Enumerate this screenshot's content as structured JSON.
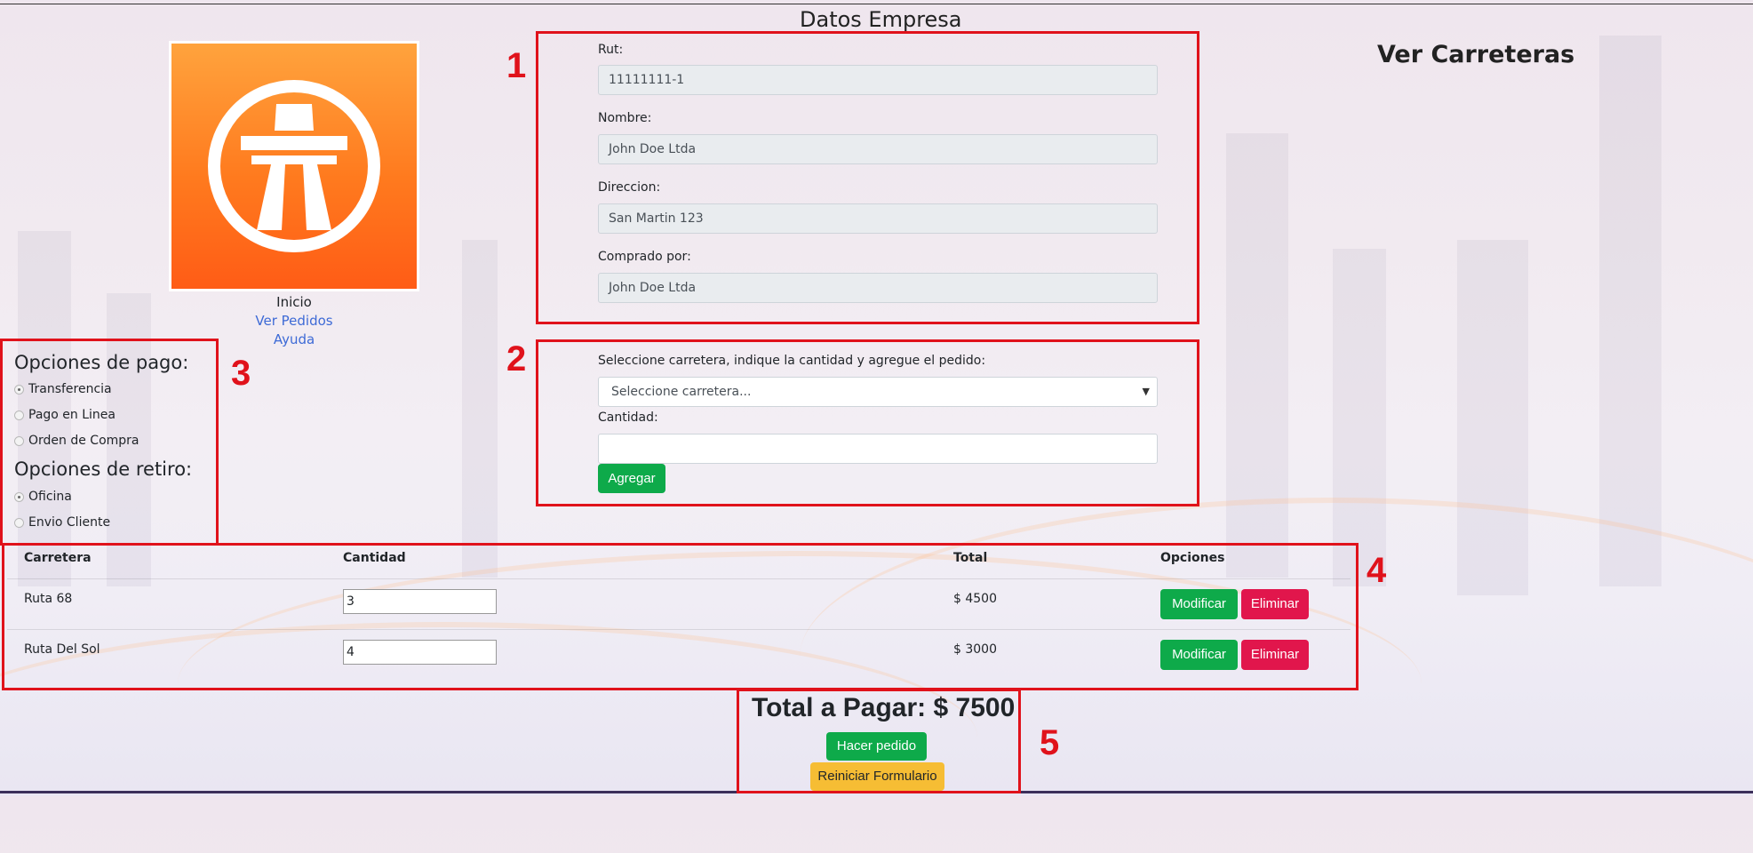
{
  "header": {
    "title": "Datos Empresa",
    "right_link": "Ver Carreteras"
  },
  "nav": {
    "inicio": "Inicio",
    "pedidos": "Ver Pedidos",
    "ayuda": "Ayuda"
  },
  "markers": [
    "1",
    "2",
    "3",
    "4",
    "5"
  ],
  "company": {
    "rut_label": "Rut:",
    "rut_value": "11111111-1",
    "nombre_label": "Nombre:",
    "nombre_value": "John Doe Ltda",
    "direccion_label": "Direccion:",
    "direccion_value": "San Martin 123",
    "comprado_label": "Comprado por:",
    "comprado_value": "John Doe Ltda"
  },
  "order_form": {
    "instruction": "Seleccione carretera, indique la cantidad y agregue el pedido:",
    "select_value": "Seleccione carretera...",
    "cantidad_label": "Cantidad:",
    "add_button": "Agregar"
  },
  "options": {
    "pago_title": "Opciones de pago:",
    "pago": [
      {
        "label": "Transferencia",
        "checked": true
      },
      {
        "label": "Pago en Linea",
        "checked": false
      },
      {
        "label": "Orden de Compra",
        "checked": false
      }
    ],
    "retiro_title": "Opciones de retiro:",
    "retiro": [
      {
        "label": "Oficina",
        "checked": true
      },
      {
        "label": "Envio Cliente",
        "checked": false
      }
    ]
  },
  "table": {
    "headers": [
      "Carretera",
      "Cantidad",
      "Total",
      "Opciones"
    ],
    "rows": [
      {
        "carretera": "Ruta 68",
        "cantidad": "3",
        "total": "$ 4500"
      },
      {
        "carretera": "Ruta Del Sol",
        "cantidad": "4",
        "total": "$ 3000"
      }
    ],
    "modify_label": "Modificar",
    "delete_label": "Eliminar"
  },
  "summary": {
    "total_text": "Total a Pagar: $ 7500",
    "submit_button": "Hacer pedido",
    "reset_button": "Reiniciar Formulario"
  },
  "colors": {
    "accent_red": "#e0121b",
    "green": "#0eaa4a",
    "danger": "#e1164c",
    "warning": "#f6bd34",
    "link": "#3d6ad6"
  }
}
